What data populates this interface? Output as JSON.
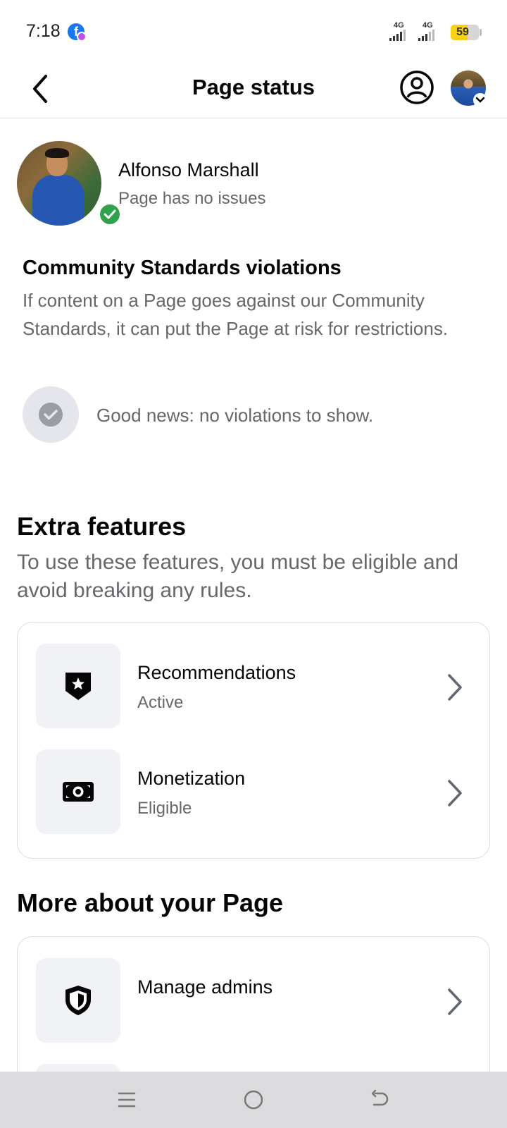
{
  "status_bar": {
    "time": "7:18",
    "app_badge_icon": "facebook-icon",
    "signal_1_label": "4G",
    "signal_2_label": "4G",
    "battery_level": "59",
    "battery_accent": "#f7d118"
  },
  "header": {
    "title": "Page status",
    "back_icon": "chevron-left-icon",
    "profile_icon": "person-circle-icon",
    "avatar_icon": "avatar"
  },
  "page": {
    "name": "Alfonso Marshall",
    "status": "Page has no issues",
    "verified_color": "#31a24c"
  },
  "community_standards": {
    "title": "Community Standards violations",
    "description": "If content on a Page goes against our Community Standards, it can put the Page at risk for restrictions.",
    "good_news": "Good news: no violations to show."
  },
  "extra_features": {
    "title": "Extra features",
    "description": "To use these features, you must be eligible and avoid breaking any rules.",
    "items": [
      {
        "title": "Recommendations",
        "subtitle": "Active",
        "icon": "badge-star-icon"
      },
      {
        "title": "Monetization",
        "subtitle": "Eligible",
        "icon": "money-icon"
      }
    ]
  },
  "more_about": {
    "title": "More about your Page",
    "items": [
      {
        "title": "Manage admins",
        "icon": "shield-icon"
      }
    ]
  },
  "nav_bar": {
    "menu_icon": "menu-icon",
    "home_icon": "home-circle-icon",
    "back_icon": "back-arrow-icon"
  }
}
